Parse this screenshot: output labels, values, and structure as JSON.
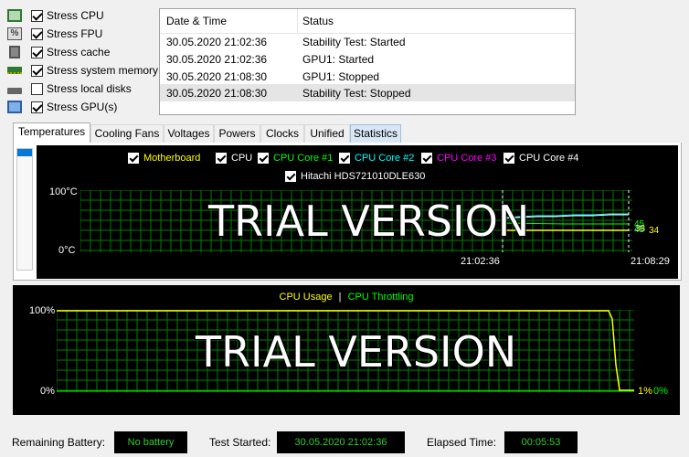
{
  "stress": [
    {
      "label": "Stress CPU",
      "checked": true,
      "icon": "cpu-icon"
    },
    {
      "label": "Stress FPU",
      "checked": true,
      "icon": "fpu-icon"
    },
    {
      "label": "Stress cache",
      "checked": true,
      "icon": "cache-icon"
    },
    {
      "label": "Stress system memory",
      "checked": true,
      "icon": "memory-icon"
    },
    {
      "label": "Stress local disks",
      "checked": false,
      "icon": "disk-icon"
    },
    {
      "label": "Stress GPU(s)",
      "checked": true,
      "icon": "gpu-icon"
    }
  ],
  "log": {
    "columns": [
      "Date & Time",
      "Status"
    ],
    "rows": [
      [
        "30.05.2020 21:02:36",
        "Stability Test: Started"
      ],
      [
        "30.05.2020 21:02:36",
        "GPU1: Started"
      ],
      [
        "30.05.2020 21:08:30",
        "GPU1: Stopped"
      ],
      [
        "30.05.2020 21:08:30",
        "Stability Test: Stopped"
      ]
    ]
  },
  "tabs": [
    "Temperatures",
    "Cooling Fans",
    "Voltages",
    "Powers",
    "Clocks",
    "Unified",
    "Statistics"
  ],
  "temp_graph": {
    "legend": [
      {
        "label": "Motherboard",
        "color": "#ffff00",
        "checked": true
      },
      {
        "label": "CPU",
        "color": "#ffffff",
        "checked": true
      },
      {
        "label": "CPU Core #1",
        "color": "#00ff00",
        "checked": true
      },
      {
        "label": "CPU Core #2",
        "color": "#00ffff",
        "checked": true
      },
      {
        "label": "CPU Core #3",
        "color": "#ff00ff",
        "checked": true
      },
      {
        "label": "CPU Core #4",
        "color": "#ffffff",
        "checked": true
      },
      {
        "label": "Hitachi HDS721010DLE630",
        "color": "#ffffff",
        "checked": true
      }
    ],
    "y_top": "100°C",
    "y_bottom": "0°C",
    "x_left": "21:02:36",
    "x_right": "21:08:29",
    "watermark": "TRIAL VERSION",
    "readings": {
      "r1": "45",
      "r2": "45",
      "r3": "38",
      "r4": "34"
    },
    "grid_color": "#008000"
  },
  "cpu_graph": {
    "legend_usage": "CPU Usage",
    "legend_sep": "|",
    "legend_throttle": "CPU Throttling",
    "usage_color": "#ffff00",
    "throttle_color": "#00ff00",
    "y_top": "100%",
    "y_bottom": "0%",
    "watermark": "TRIAL VERSION",
    "usage_value": "1%",
    "throttle_value": "0%"
  },
  "status": {
    "battery_label": "Remaining Battery:",
    "battery_value": "No battery",
    "started_label": "Test Started:",
    "started_value": "30.05.2020 21:02:36",
    "elapsed_label": "Elapsed Time:",
    "elapsed_value": "00:05:53"
  }
}
